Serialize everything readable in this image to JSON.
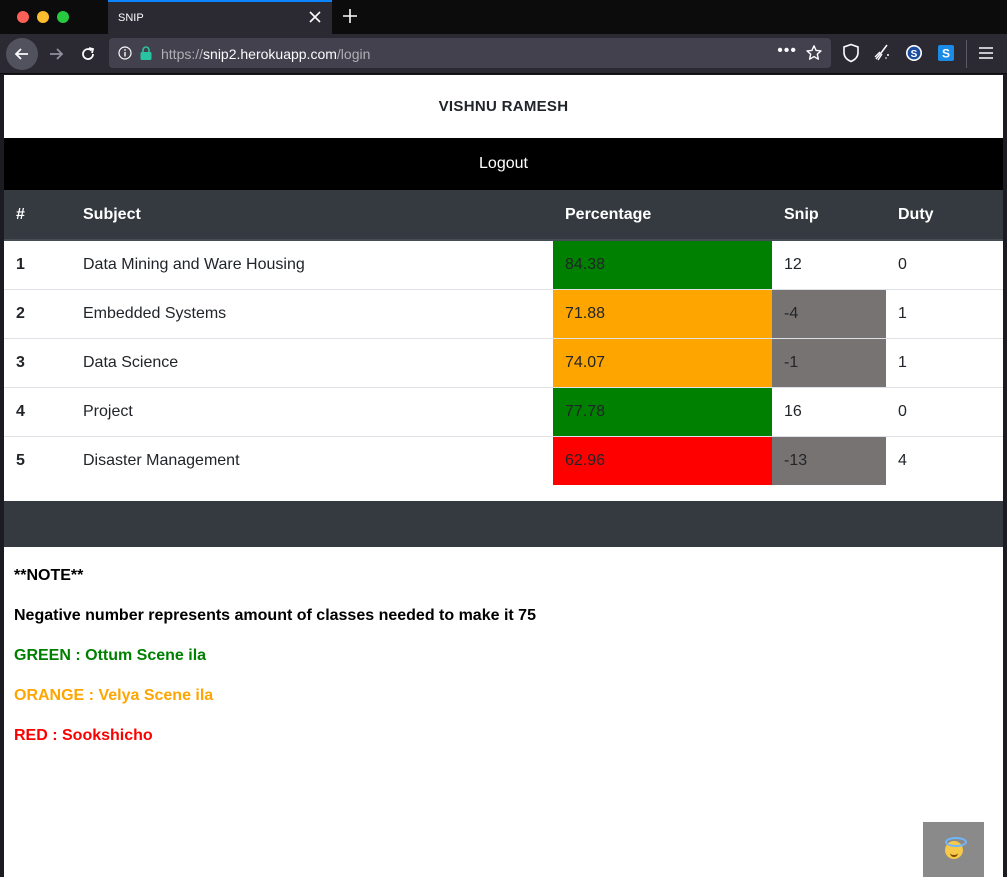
{
  "browser": {
    "tab_title": "SNIP",
    "url_prefix": "https://",
    "url_host": "snip2.herokuapp.com",
    "url_path": "/login",
    "url_menu": "•••"
  },
  "page": {
    "user_name": "VISHNU RAMESH",
    "logout_label": "Logout",
    "columns": [
      "#",
      "Subject",
      "Percentage",
      "Snip",
      "Duty"
    ],
    "rows": [
      {
        "num": "1",
        "subject": "Data Mining and Ware Housing",
        "percentage": "84.38",
        "snip": "12",
        "duty": "0",
        "pct_color": "#008000",
        "snip_color": ""
      },
      {
        "num": "2",
        "subject": "Embedded Systems",
        "percentage": "71.88",
        "snip": "-4",
        "duty": "1",
        "pct_color": "#ffa500",
        "snip_color": "#787373"
      },
      {
        "num": "3",
        "subject": "Data Science",
        "percentage": "74.07",
        "snip": "-1",
        "duty": "1",
        "pct_color": "#ffa500",
        "snip_color": "#787373"
      },
      {
        "num": "4",
        "subject": "Project",
        "percentage": "77.78",
        "snip": "16",
        "duty": "0",
        "pct_color": "#008000",
        "snip_color": ""
      },
      {
        "num": "5",
        "subject": "Disaster Management",
        "percentage": "62.96",
        "snip": "-13",
        "duty": "4",
        "pct_color": "#ff0000",
        "snip_color": "#787373"
      }
    ],
    "notes": {
      "heading": "**NOTE**",
      "negative": "Negative number represents amount of classes needed to make it 75",
      "green": "GREEN : Ottum Scene ila",
      "orange": "ORANGE : Velya Scene ila",
      "red": "RED : Sookshicho"
    },
    "emoji_button_icon": "smiling-face-with-halo-icon"
  }
}
